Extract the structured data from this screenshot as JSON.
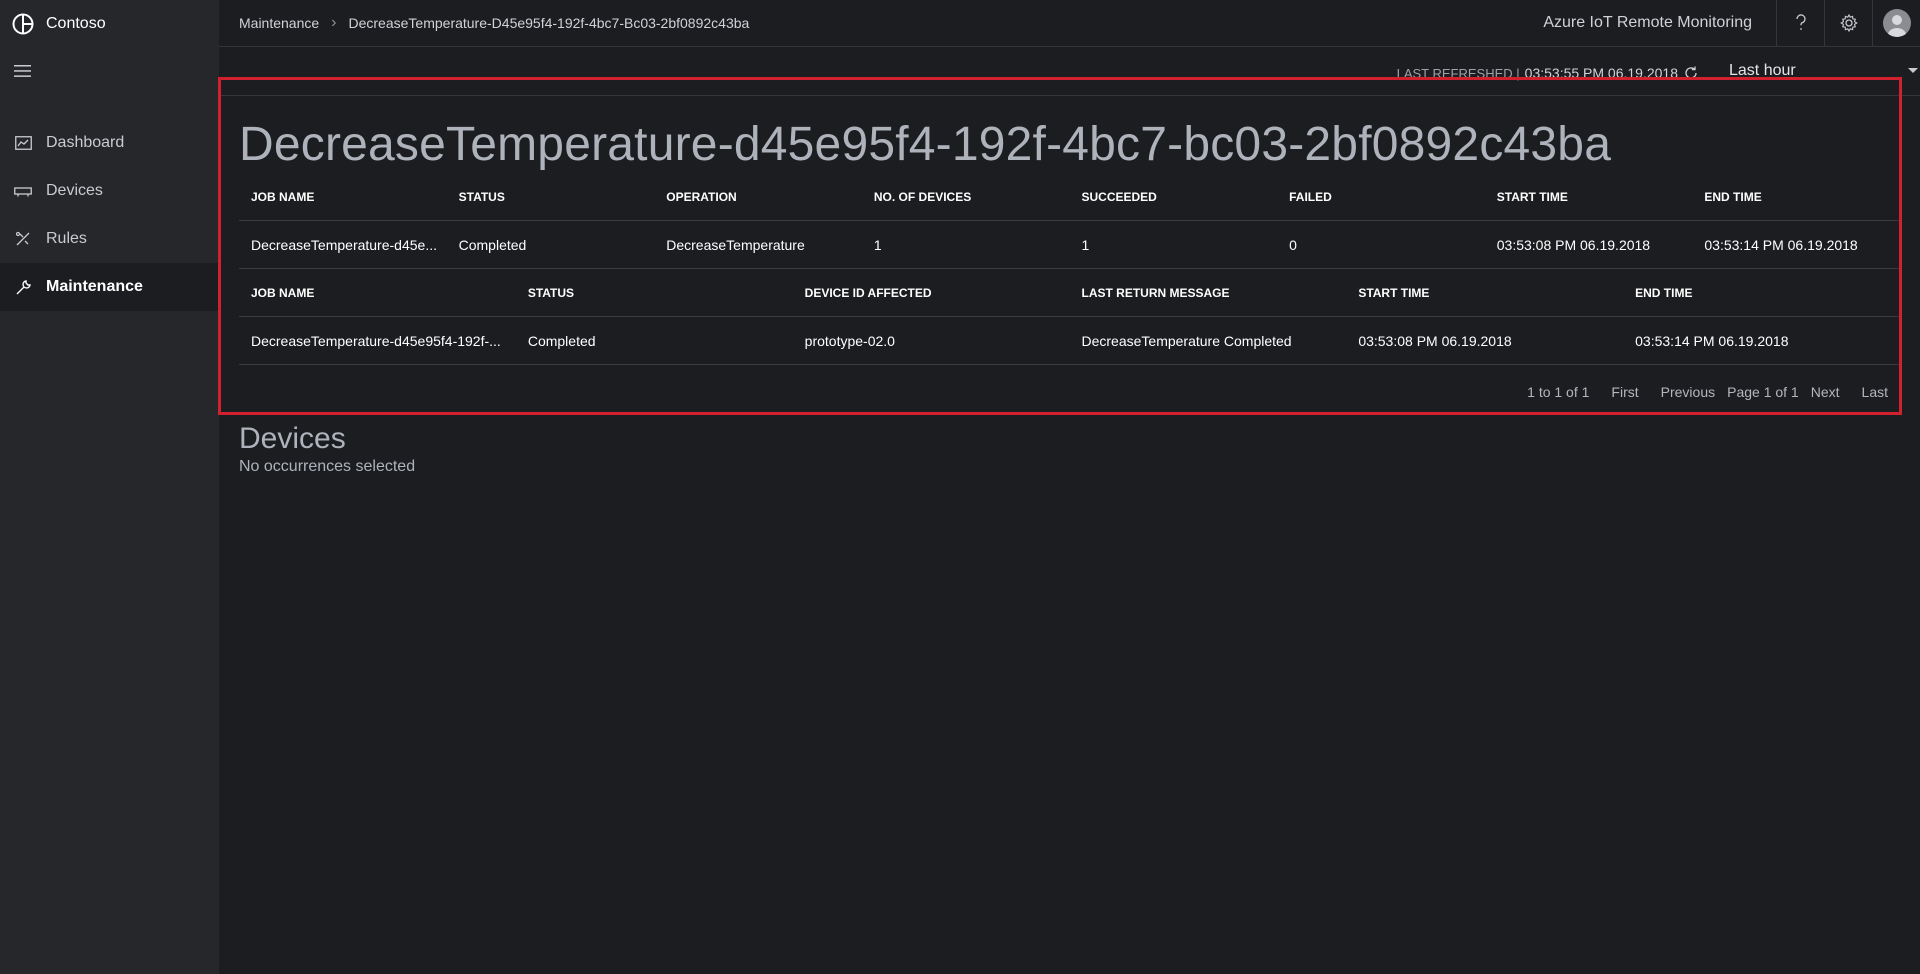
{
  "brand": {
    "name": "Contoso"
  },
  "sidebar": {
    "items": [
      {
        "label": "Dashboard",
        "icon": "dashboard-icon"
      },
      {
        "label": "Devices",
        "icon": "devices-icon"
      },
      {
        "label": "Rules",
        "icon": "rules-icon"
      },
      {
        "label": "Maintenance",
        "icon": "maintenance-icon",
        "active": true
      }
    ]
  },
  "topbar": {
    "breadcrumb": {
      "parent": "Maintenance",
      "current": "DecreaseTemperature-D45e95f4-192f-4bc7-Bc03-2bf0892c43ba"
    },
    "app_title": "Azure IoT Remote Monitoring",
    "help_icon": "help-icon",
    "settings_icon": "gear-icon"
  },
  "refresh": {
    "label": "LAST REFRESHED |",
    "time": "03:53:55 PM 06.19.2018",
    "time_range": "Last hour"
  },
  "job": {
    "title": "DecreaseTemperature-d45e95f4-192f-4bc7-bc03-2bf0892c43ba",
    "summary_grid": {
      "columns": [
        "JOB NAME",
        "STATUS",
        "OPERATION",
        "NO. OF DEVICES",
        "SUCCEEDED",
        "FAILED",
        "START TIME",
        "END TIME"
      ],
      "rows": [
        [
          "DecreaseTemperature-d45e...",
          "Completed",
          "DecreaseTemperature",
          "1",
          "1",
          "0",
          "03:53:08 PM 06.19.2018",
          "03:53:14 PM 06.19.2018"
        ]
      ]
    },
    "device_grid": {
      "columns": [
        "JOB NAME",
        "STATUS",
        "DEVICE ID AFFECTED",
        "LAST RETURN MESSAGE",
        "START TIME",
        "END TIME"
      ],
      "rows": [
        [
          "DecreaseTemperature-d45e95f4-192f-...",
          "Completed",
          "prototype-02.0",
          "DecreaseTemperature Completed",
          "03:53:08 PM 06.19.2018",
          "03:53:14 PM 06.19.2018"
        ]
      ]
    },
    "pagination": {
      "count": "1 to 1 of 1",
      "first": "First",
      "previous": "Previous",
      "page_info": "Page 1 of 1",
      "next": "Next",
      "last": "Last"
    }
  },
  "devices": {
    "title": "Devices",
    "subtitle": "No occurrences selected"
  },
  "colors": {
    "background": "#1c1d21",
    "sidebar": "#26272b",
    "highlight": "#d1202e",
    "title_text": "#aeb3bb"
  }
}
